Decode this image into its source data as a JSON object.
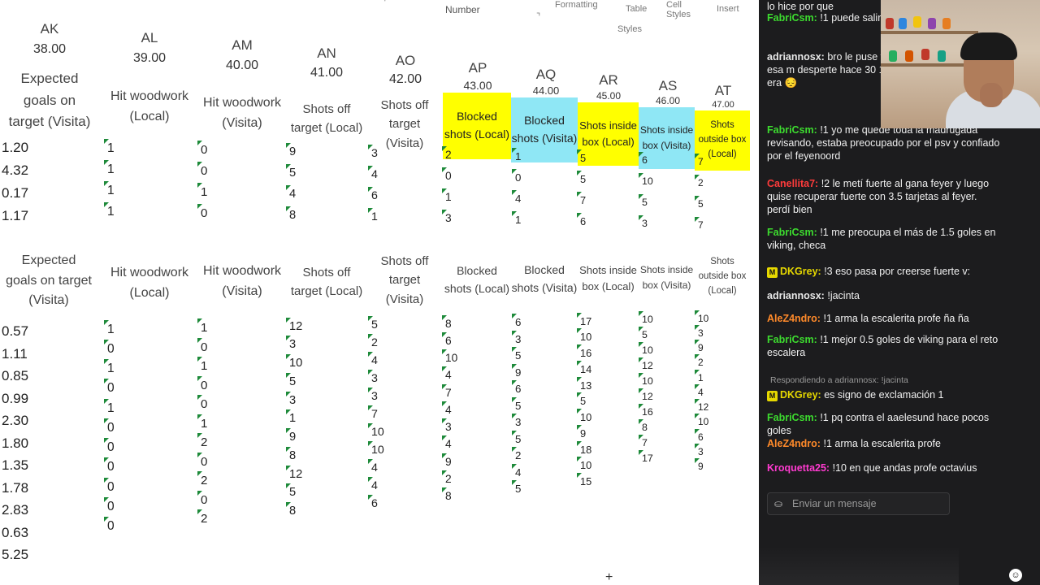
{
  "ribbon": {
    "number_label": "Number",
    "formatting_label": "Formatting",
    "table_label": "Table",
    "cell_styles_label": "Cell Styles",
    "styles_group": "Styles",
    "insert_label": "Insert"
  },
  "columns": [
    {
      "letter": "AK",
      "num": "38.00",
      "header": "Expected goals on target (Visita)"
    },
    {
      "letter": "AL",
      "num": "39.00",
      "header": "Hit woodwork (Local)"
    },
    {
      "letter": "AM",
      "num": "40.00",
      "header": "Hit woodwork (Visita)"
    },
    {
      "letter": "AN",
      "num": "41.00",
      "header": "Shots off target (Local)"
    },
    {
      "letter": "AO",
      "num": "42.00",
      "header": "Shots off target (Visita)"
    },
    {
      "letter": "AP",
      "num": "43.00",
      "header": "Blocked shots (Local)"
    },
    {
      "letter": "AQ",
      "num": "44.00",
      "header": "Blocked shots (Visita)"
    },
    {
      "letter": "AR",
      "num": "45.00",
      "header": "Shots inside box (Local)"
    },
    {
      "letter": "AS",
      "num": "46.00",
      "header": "Shots inside box (Visita)"
    },
    {
      "letter": "AT",
      "num": "47.00",
      "header": "Shots outside box (Local)"
    }
  ],
  "upper_rows": {
    "ak": [
      "1.20",
      "4.32",
      "0.17",
      "1.17"
    ],
    "al": [
      "1",
      "1",
      "1",
      "1"
    ],
    "am": [
      "0",
      "0",
      "1",
      "0"
    ],
    "an": [
      "9",
      "5",
      "4",
      "8"
    ],
    "ao": [
      "3",
      "4",
      "6",
      "1"
    ],
    "ap": [
      "2",
      "0",
      "1",
      "3"
    ],
    "aq": [
      "1",
      "0",
      "4",
      "1"
    ],
    "ar": [
      "5",
      "5",
      "7",
      "6"
    ],
    "as": [
      "6",
      "10",
      "5",
      "3"
    ],
    "at": [
      "7",
      "2",
      "5",
      "7"
    ]
  },
  "lower_headers": [
    "Expected goals on target (Visita)",
    "Hit woodwork (Local)",
    "Hit woodwork (Visita)",
    "Shots off target (Local)",
    "Shots off target (Visita)",
    "Blocked shots (Local)",
    "Blocked shots (Visita)",
    "Shots inside box (Local)",
    "Shots inside box (Visita)",
    "Shots outside box (Local)"
  ],
  "lower_rows": {
    "ak": [
      "0.57",
      "1.11",
      "0.85",
      "0.99",
      "2.30",
      "1.80",
      "1.35",
      "1.78",
      "2.83",
      "0.63",
      "5.25"
    ],
    "al": [
      "1",
      "0",
      "1",
      "0",
      "1",
      "0",
      "0",
      "0",
      "0",
      "0",
      "0"
    ],
    "am": [
      "1",
      "0",
      "1",
      "0",
      "0",
      "1",
      "2",
      "0",
      "2",
      "0",
      "2"
    ],
    "an": [
      "12",
      "3",
      "10",
      "5",
      "3",
      "1",
      "9",
      "8",
      "12",
      "5",
      "8"
    ],
    "ao": [
      "5",
      "2",
      "4",
      "3",
      "3",
      "7",
      "10",
      "10",
      "4",
      "4",
      "6"
    ],
    "ap": [
      "8",
      "6",
      "10",
      "4",
      "7",
      "4",
      "3",
      "4",
      "9",
      "2",
      "8"
    ],
    "aq": [
      "6",
      "3",
      "5",
      "9",
      "6",
      "5",
      "3",
      "5",
      "2",
      "4",
      "5"
    ],
    "ar": [
      "17",
      "10",
      "16",
      "14",
      "13",
      "5",
      "10",
      "9",
      "18",
      "10",
      "15"
    ],
    "as": [
      "10",
      "5",
      "10",
      "12",
      "10",
      "12",
      "16",
      "8",
      "7",
      "17"
    ],
    "at": [
      "10",
      "3",
      "9",
      "2",
      "1",
      "4",
      "12",
      "10",
      "6",
      "3",
      "9"
    ]
  },
  "chat": {
    "messages": [
      {
        "user": "",
        "text": "lo hice por que",
        "color": "#f0f0f0"
      },
      {
        "user": "FabriCsm:",
        "text": "!1 puede salir un madrid malaga?",
        "color": "#3ddc2f"
      },
      {
        "user": "adriannosx:",
        "text": "bro le puse toc hice otra más fija con esa m desperte hace 30 1 hora y y reciben tarjeta era 😔",
        "color": "#e8e8e8"
      },
      {
        "user": "FabriCsm:",
        "text": "!1 yo me quedé toda la madrugada revisando, estaba preocupado por el psv y confiado por el feyenoord",
        "color": "#3ddc2f"
      },
      {
        "user": "Canellita7:",
        "text": "!2 le metí fuerte al gana feyer y luego quise recuperar fuerte con 3.5 tarjetas al feyer. perdí bien",
        "color": "#ff3b3b"
      },
      {
        "user": "FabriCsm:",
        "text": "!1 me preocupa el más de 1.5 goles en viking, checa",
        "color": "#3ddc2f"
      },
      {
        "user": "DKGrey:",
        "text": "!3 eso pasa por creerse fuerte v:",
        "color": "#e6d800"
      },
      {
        "user": "adriannosx:",
        "text": "!jacinta",
        "color": "#e8e8e8"
      },
      {
        "user": "AleZ4ndro:",
        "text": "!1 arma la escalerita profe ña ña",
        "color": "#ff8a2a"
      },
      {
        "user": "FabriCsm:",
        "text": "!1 mejor 0.5 goles de viking para el reto escalera",
        "color": "#3ddc2f"
      },
      {
        "user": "DKGrey:",
        "text": "es signo de exclamación 1",
        "color": "#e6d800"
      },
      {
        "user": "FabriCsm:",
        "text": "!1 pq contra el aaelesund hace pocos goles",
        "color": "#3ddc2f"
      },
      {
        "user": "AleZ4ndro:",
        "text": "!1 arma la escalerita profe",
        "color": "#ff8a2a"
      },
      {
        "user": "Kroquetta25:",
        "text": "!10 en que andas profe octavius",
        "color": "#ff3bd0"
      }
    ],
    "reply_note": "Respondiendo a adriannosx: !jacinta",
    "input_placeholder": "Enviar un mensaje",
    "badge_letter": "M"
  },
  "icons": {
    "chat_smile": "smile-icon",
    "cursor": "plus-cursor-icon"
  }
}
